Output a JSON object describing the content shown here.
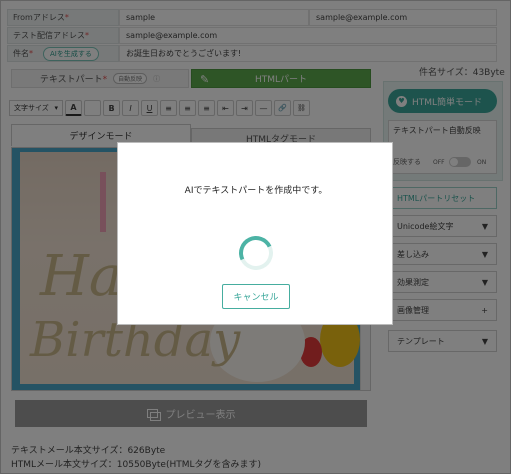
{
  "header": {
    "from_label": "Fromアドレス",
    "from_value": "sample",
    "from_value2": "sample@example.com",
    "test_label": "テスト配信アドレス",
    "test_value": "sample@example.com",
    "subject_label": "件名",
    "ai_button": "AIを生成する",
    "subject_value": "お誕生日おめでとうございます!",
    "required_mark": "*"
  },
  "subject_size": "件名サイズ：43Byte",
  "parts": {
    "text_part": "テキストパート",
    "auto_reflect": "自動反映",
    "html_part": "HTMLパート"
  },
  "toolbar": {
    "font_size": "文字サイズ",
    "buttons": [
      "A",
      "",
      "B",
      "I",
      "U",
      "≡",
      "≡",
      "≡",
      "⇤",
      "⇥",
      "—",
      "🔗",
      "⛓"
    ]
  },
  "modes": {
    "design": "デザインモード",
    "html_tag": "HTMLタグモード"
  },
  "preview_button": "プレビュー表示",
  "sizes": {
    "text_size": "テキストメール本文サイズ：626Byte",
    "html_size": "HTMLメール本文サイズ：10550Byte(HTMLタグを含みます)"
  },
  "sidebar": {
    "easy_mode": "HTML簡単モード",
    "auto_reflect_title": "テキストパート自動反映",
    "auto_reflect_desc": "",
    "reflect_label": "反映する",
    "off": "OFF",
    "on": "ON",
    "items": [
      {
        "label": "HTMLパートリセット",
        "icon": ""
      },
      {
        "label": "Unicode絵文字",
        "icon": "▼"
      },
      {
        "label": "差し込み",
        "icon": "▼"
      },
      {
        "label": "効果測定",
        "icon": "▼"
      },
      {
        "label": "画像管理",
        "icon": "+"
      },
      {
        "label": "テンプレート",
        "icon": "▼"
      }
    ]
  },
  "modal": {
    "message": "AIでテキストパートを作成中です。",
    "cancel": "キャンセル"
  },
  "colors": {
    "accent": "#3aa79a",
    "html_tab": "#5daa4c",
    "overlay": "rgba(0,0,0,0.5)"
  }
}
